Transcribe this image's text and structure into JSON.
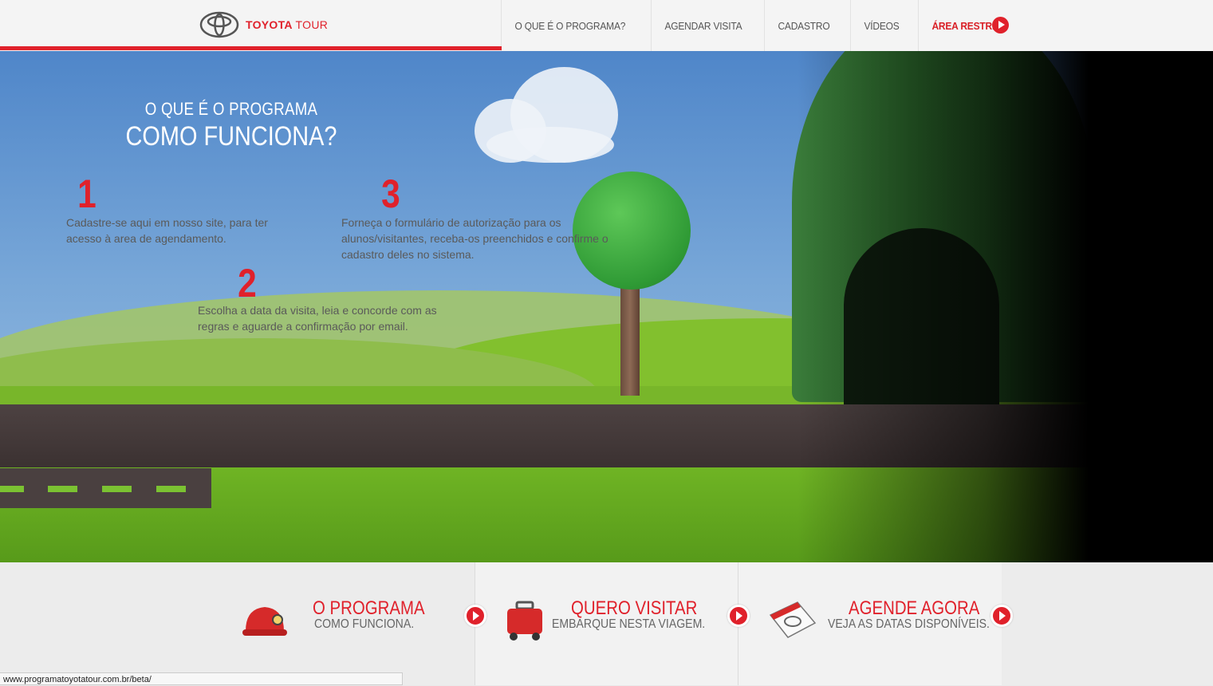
{
  "header": {
    "brand_main": "TOYOTA",
    "brand_sub": "TOUR",
    "nav": [
      "O QUE É O PROGRAMA?",
      "AGENDAR VISITA",
      "CADASTRO",
      "VÍDEOS",
      "ÁREA RESTRITA"
    ]
  },
  "hero": {
    "pre_title": "O QUE É O PROGRAMA",
    "title": "COMO FUNCIONA?",
    "steps": [
      {
        "number": "1",
        "text": "Cadastre-se aqui em nosso site, para ter acesso à area de agendamento."
      },
      {
        "number": "2",
        "text": "Escolha a data da visita, leia e concorde com as regras e aguarde a confirmação por email."
      },
      {
        "number": "3",
        "text": "Forneça o formulário de autorização para os alunos/visitantes, receba-os preenchidos e confirme o cadastro deles no sistema."
      }
    ]
  },
  "cards": [
    {
      "title": "O PROGRAMA",
      "subtitle": "COMO FUNCIONA.",
      "icon": "helmet-icon"
    },
    {
      "title": "QUERO VISITAR",
      "subtitle": "EMBARQUE NESTA VIAGEM.",
      "icon": "suitcase-icon"
    },
    {
      "title": "AGENDE AGORA",
      "subtitle": "VEJA AS DATAS DISPONÍVEIS.",
      "icon": "calendar-icon"
    }
  ],
  "status_bar": {
    "url": "www.programatoyotatour.com.br/beta/"
  },
  "colors": {
    "accent": "#e0212b"
  }
}
